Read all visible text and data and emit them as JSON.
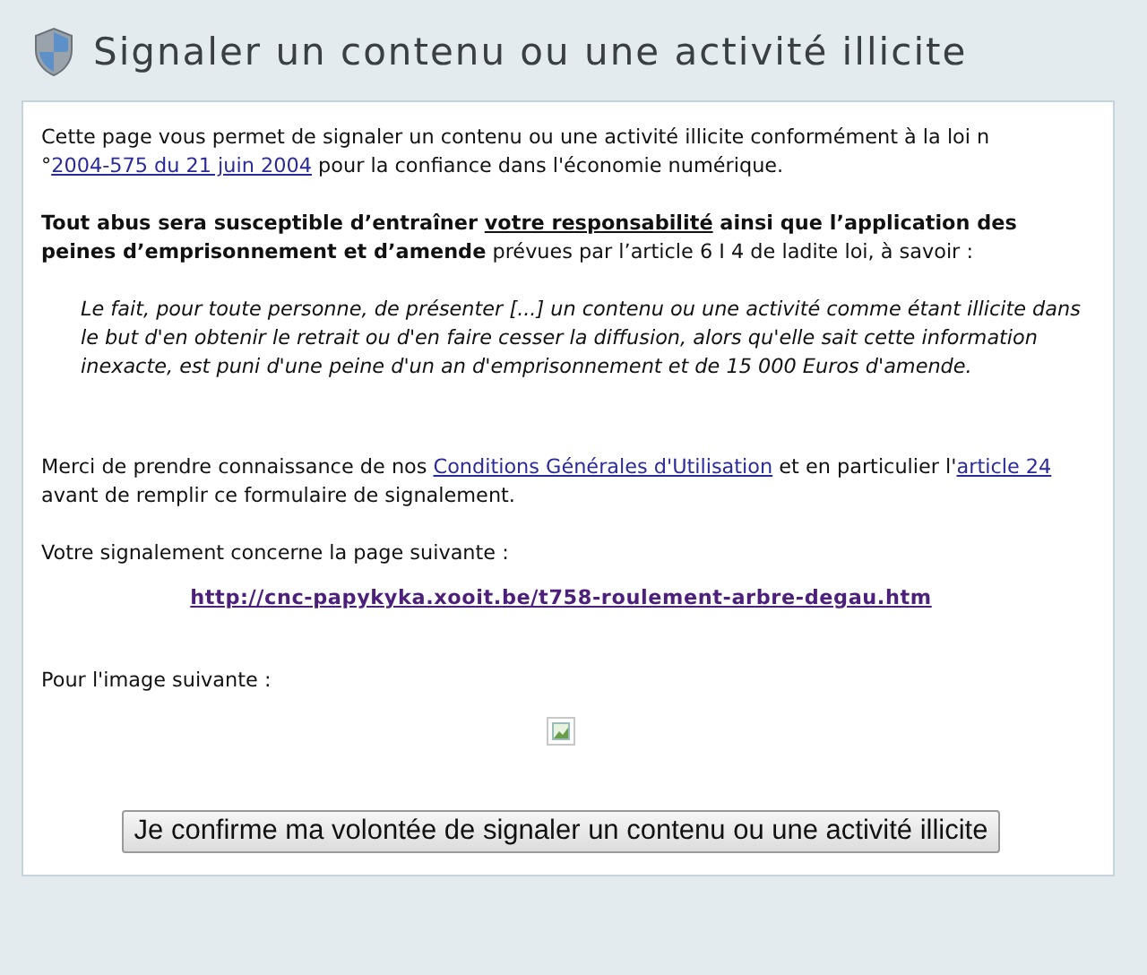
{
  "title": "Signaler un contenu ou une activité illicite",
  "intro": [
    {
      "kind": "text",
      "text": "Cette page vous permet de signaler un contenu ou une activité illicite conformément à la loi n °"
    },
    {
      "kind": "link",
      "text": "2004-575 du 21 juin 2004"
    },
    {
      "kind": "text",
      "text": " pour la confiance dans l'économie numérique."
    }
  ],
  "warning": [
    {
      "kind": "bold",
      "text": "Tout abus sera susceptible d’entraîner "
    },
    {
      "kind": "underlined",
      "text": "votre responsabilité"
    },
    {
      "kind": "bold",
      "text": " ainsi que l’application des peines d’emprisonnement et d’amende"
    },
    {
      "kind": "text",
      "text": " prévues par l’article 6 I 4 de ladite loi, à savoir :"
    }
  ],
  "quote": "Le fait, pour toute personne, de présenter [...] un contenu ou une activité comme étant illicite dans le but d'en obtenir le retrait ou d'en faire cesser la diffusion, alors qu'elle sait cette information inexacte, est puni d'une peine d'un an d'emprisonnement et de 15 000 Euros d'amende.",
  "terms": [
    {
      "kind": "text",
      "text": "Merci de prendre connaissance de nos "
    },
    {
      "kind": "link",
      "text": "Conditions Générales d'Utilisation"
    },
    {
      "kind": "text",
      "text": " et en particulier l'"
    },
    {
      "kind": "link",
      "text": "article 24"
    },
    {
      "kind": "text",
      "text": " avant de remplir ce formulaire de signalement."
    }
  ],
  "page_label": "Votre signalement concerne la page suivante :",
  "page_url": "http://cnc-papykyka.xooit.be/t758-roulement-arbre-degau.htm",
  "image_label": "Pour l'image suivante :",
  "image": {
    "kind": "broken"
  },
  "confirm_button": "Je confirme ma volontée de signaler un contenu ou une activité illicite"
}
